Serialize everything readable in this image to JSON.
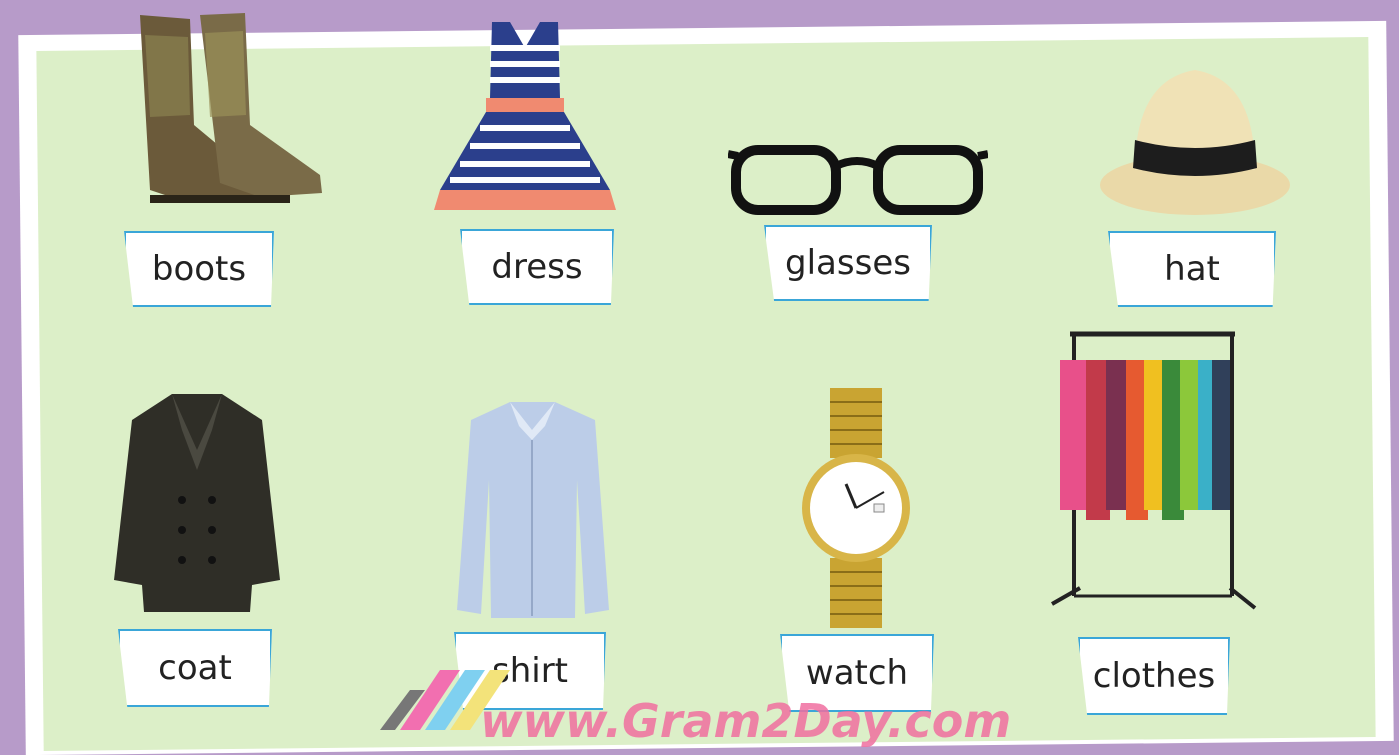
{
  "items": [
    {
      "label": "boots",
      "icon": "boots-icon"
    },
    {
      "label": "dress",
      "icon": "dress-icon"
    },
    {
      "label": "glasses",
      "icon": "glasses-icon"
    },
    {
      "label": "hat",
      "icon": "hat-icon"
    },
    {
      "label": "coat",
      "icon": "coat-icon"
    },
    {
      "label": "shirt",
      "icon": "shirt-icon"
    },
    {
      "label": "watch",
      "icon": "watch-icon"
    },
    {
      "label": "clothes",
      "icon": "clothes-rack-icon"
    }
  ],
  "watermark": "www.Gram2Day.com",
  "colors": {
    "background": "#b79bc9",
    "panel": "#dcefc8",
    "label_border": "#3aa6d8"
  }
}
